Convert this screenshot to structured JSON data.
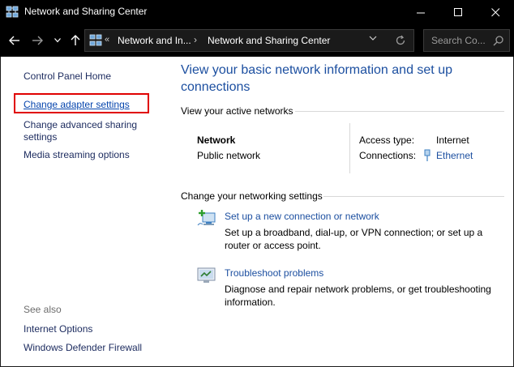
{
  "window": {
    "title": "Network and Sharing Center",
    "minimize_glyph": "—",
    "maximize_glyph": "☐",
    "close_glyph": "✕"
  },
  "navigation": {
    "back_glyph": "←",
    "forward_glyph": "→",
    "recent_glyph": "⌄",
    "up_glyph": "↑"
  },
  "address_bar": {
    "overflow": "«",
    "crumb_1": "Network and In...",
    "separator": "›",
    "crumb_2": "Network and Sharing Center"
  },
  "search": {
    "placeholder": "Search Co..."
  },
  "left_nav": {
    "home": "Control Panel Home",
    "change_adapter": "Change adapter settings",
    "change_sharing_line1": "Change advanced sharing",
    "change_sharing_line2": "settings",
    "media_streaming": "Media streaming options",
    "see_also": "See also",
    "internet_options": "Internet Options",
    "firewall": "Windows Defender Firewall"
  },
  "main": {
    "heading_line1": "View your basic network information and set up",
    "heading_line2": "connections",
    "active_networks_label": "View your active networks",
    "network_name": "Network",
    "network_type": "Public network",
    "access_type_label": "Access type:",
    "access_type_value": "Internet",
    "connections_label": "Connections:",
    "connections_value": "Ethernet",
    "change_settings_label": "Change your networking settings",
    "task1_link": "Set up a new connection or network",
    "task1_desc": "Set up a broadband, dial-up, or VPN connection; or set up a router or access point.",
    "task2_link": "Troubleshoot problems",
    "task2_desc": "Diagnose and repair network problems, or get troubleshooting information."
  },
  "colors": {
    "titlebar_bg": "#000000",
    "link": "#1c4fa0",
    "heading": "#1c4fa0",
    "highlight": "#e00000"
  }
}
